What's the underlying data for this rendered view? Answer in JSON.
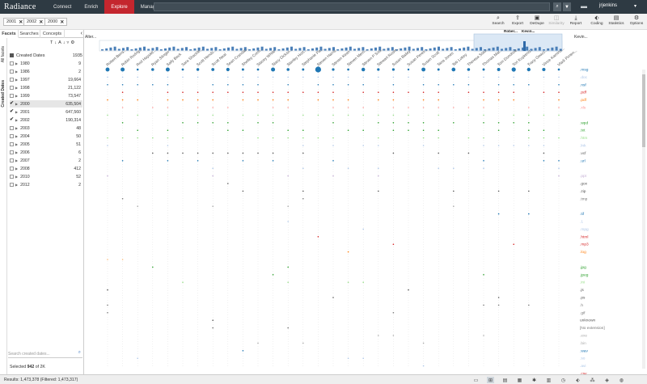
{
  "app": {
    "logo": "Radiance"
  },
  "nav": {
    "items": [
      {
        "label": "Connect",
        "active": false
      },
      {
        "label": "Enrich",
        "active": false
      },
      {
        "label": "Explore",
        "active": true
      },
      {
        "label": "Manage",
        "active": false
      }
    ],
    "search_value": "",
    "user": "jrjenkins"
  },
  "chips": [
    {
      "label": "2001"
    },
    {
      "label": "2002"
    },
    {
      "label": "2000"
    }
  ],
  "toolbar": [
    {
      "label": "Search",
      "icon": "search-icon",
      "disabled": false
    },
    {
      "label": "Export",
      "icon": "export-icon",
      "disabled": false
    },
    {
      "label": "DeDupe",
      "icon": "dedupe-icon",
      "disabled": false
    },
    {
      "label": "Similarity",
      "icon": "similarity-icon",
      "disabled": true
    },
    {
      "label": "Report",
      "icon": "download-icon",
      "disabled": false
    },
    {
      "label": "Coding",
      "icon": "tag-icon",
      "disabled": false
    },
    {
      "label": "Statistics",
      "icon": "chart-icon",
      "disabled": false
    },
    {
      "label": "Options",
      "icon": "gear-icon",
      "disabled": false
    }
  ],
  "left_panel": {
    "tabs": [
      "Facets",
      "Searches",
      "Concepts"
    ],
    "vertical_tabs": [
      "All facets",
      "Created Dates"
    ],
    "facet_title": "Created Dates",
    "facet_total": "1935",
    "facets": [
      {
        "label": "1980",
        "count": "9",
        "checked": false,
        "selected": false
      },
      {
        "label": "1986",
        "count": "2",
        "checked": false,
        "selected": false
      },
      {
        "label": "1997",
        "count": "19,664",
        "checked": false,
        "selected": false
      },
      {
        "label": "1998",
        "count": "21,122",
        "checked": false,
        "selected": false
      },
      {
        "label": "1999",
        "count": "73,547",
        "checked": false,
        "selected": false
      },
      {
        "label": "2000",
        "count": "635,504",
        "checked": true,
        "selected": true
      },
      {
        "label": "2001",
        "count": "647,560",
        "checked": true,
        "selected": false
      },
      {
        "label": "2002",
        "count": "190,314",
        "checked": true,
        "selected": false
      },
      {
        "label": "2003",
        "count": "48",
        "checked": false,
        "selected": false
      },
      {
        "label": "2004",
        "count": "50",
        "checked": false,
        "selected": false
      },
      {
        "label": "2005",
        "count": "51",
        "checked": false,
        "selected": false
      },
      {
        "label": "2006",
        "count": "6",
        "checked": false,
        "selected": false
      },
      {
        "label": "2007",
        "count": "2",
        "checked": false,
        "selected": false
      },
      {
        "label": "2008",
        "count": "412",
        "checked": false,
        "selected": false
      },
      {
        "label": "2010",
        "count": "52",
        "checked": false,
        "selected": false
      },
      {
        "label": "2012",
        "count": "2",
        "checked": false,
        "selected": false
      }
    ],
    "search_placeholder": "Search created dates...",
    "selected_prefix": "Selected ",
    "selected_count": "942",
    "selected_suffix": " of 2K"
  },
  "viz": {
    "overview_label": "Alter...",
    "overview_right_label": "Kevin...",
    "overview_top_labels": [
      "Rober...",
      "Kevin..."
    ],
    "columns": [
      "Robert Bens...",
      "Robin Rodrig...",
      "Rod Hayslet...",
      "Ryan Slinger",
      "Sally Beck",
      "Sara Shackle...",
      "Scott Hends...",
      "Scott Neal",
      "Sean Crandal...",
      "Shelley Corm...",
      "Stacey White",
      "Stacy Dickso...",
      "Stanley Hort...",
      "Stephanie Pa...",
      "Steven Harris",
      "Steven Kean",
      "Steven Merri...",
      "Steven P Sou...",
      "Stewart Rosm...",
      "Susan Bailey",
      "Susan Pereir...",
      "Susan Scott",
      "Tana Jones",
      "Teb Lokey",
      "Theresa Stau...",
      "Thomas Mar...",
      "Tom Donohoe",
      "Tori Kuykend...",
      "Tracy Geacc...",
      "Vince Kamins...",
      "Vladi Pimen..."
    ],
    "rows": [
      {
        "label": ".msg",
        "color": "#1f77b4"
      },
      {
        "label": ".doc",
        "color": "#aec7e8"
      },
      {
        "label": ".nsf",
        "color": "#1f77b4"
      },
      {
        "label": ".pdf",
        "color": "#d62728"
      },
      {
        "label": ".pdf",
        "color": "#ff7f0e"
      },
      {
        "label": ".xls",
        "color": "#ff9896"
      },
      {
        "label": "",
        "color": "#98df8a"
      },
      {
        "label": ".wpd",
        "color": "#2ca02c"
      },
      {
        "label": ".txt",
        "color": "#2ca02c"
      },
      {
        "label": ".htm",
        "color": "#98df8a"
      },
      {
        "label": ".lnk",
        "color": "#aec7e8"
      },
      {
        "label": ".vcf",
        "color": "#555555"
      },
      {
        "label": ".url",
        "color": "#1f77b4"
      },
      {
        "label": "",
        "color": "#aec7e8"
      },
      {
        "label": ".ppt",
        "color": "#c5b0d5"
      },
      {
        "label": ".gox",
        "color": "#555555"
      },
      {
        "label": ".zip",
        "color": "#555555"
      },
      {
        "label": ".tmp",
        "color": "#777777"
      },
      {
        "label": "",
        "color": "#aaaaaa"
      },
      {
        "label": ".tif",
        "color": "#1f77b4"
      },
      {
        "label": ".1",
        "color": "#aec7e8"
      },
      {
        "label": ".mpg",
        "color": "#aec7e8"
      },
      {
        "label": ".html",
        "color": "#d62728"
      },
      {
        "label": ".mp3",
        "color": "#d62728"
      },
      {
        "label": ".log",
        "color": "#ff7f0e"
      },
      {
        "label": "",
        "color": "#ffbb78"
      },
      {
        "label": ".jpg",
        "color": "#2ca02c"
      },
      {
        "label": ".jpeg",
        "color": "#2ca02c"
      },
      {
        "label": ".ini",
        "color": "#98df8a"
      },
      {
        "label": ".js",
        "color": "#555555"
      },
      {
        "label": ".ps",
        "color": "#555555"
      },
      {
        "label": ".h",
        "color": "#777777"
      },
      {
        "label": ".gif",
        "color": "#777777"
      },
      {
        "label": "unknown",
        "color": "#555555"
      },
      {
        "label": "[No extension]",
        "color": "#777777"
      },
      {
        "label": ".exe",
        "color": "#aaaaaa"
      },
      {
        "label": ".bin",
        "color": "#aaaaaa"
      },
      {
        "label": ".wav",
        "color": "#1f77b4"
      },
      {
        "label": ".so",
        "color": "#aec7e8"
      },
      {
        "label": ".avi",
        "color": "#aec7e8"
      },
      {
        "label": ".csv",
        "color": "#d62728"
      },
      {
        "label": ".xml",
        "color": "#ff7f0e"
      }
    ]
  },
  "status": {
    "results": "Results: 1,473,378 (Filtered: 1,473,317)"
  }
}
